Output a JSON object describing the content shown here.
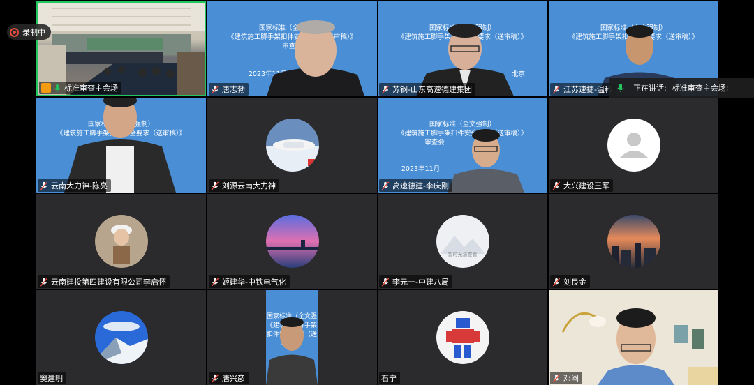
{
  "recording": {
    "label": "录制中"
  },
  "speaking": {
    "label": "正在讲话:",
    "name": "标准审查主会场;"
  },
  "slide": {
    "line1": "国家标准（全文强制）",
    "line2": "《建筑施工脚手架扣件安全要求（送审稿）》",
    "line3": "审查会",
    "date": "2023年11月",
    "place": "北京"
  },
  "participants": [
    {
      "name": "标准审查主会场",
      "kind": "room-video",
      "mic": "on"
    },
    {
      "name": "唐志勃",
      "kind": "slide-video",
      "mic": "muted"
    },
    {
      "name": "苏钢-山东高速德建集团",
      "kind": "slide-video",
      "mic": "muted"
    },
    {
      "name": "江苏速捷-温科",
      "kind": "slide-video",
      "mic": "muted"
    },
    {
      "name": "云南大力神-陈亮",
      "kind": "slide-video",
      "mic": "muted"
    },
    {
      "name": "刘源云南大力神",
      "kind": "avatar",
      "avatar": "airplane-avatar",
      "mic": "muted"
    },
    {
      "name": "高速德建-李庆刚",
      "kind": "slide-video",
      "mic": "muted"
    },
    {
      "name": "大兴建设王军",
      "kind": "avatar",
      "avatar": "default-person-avatar",
      "mic": "muted"
    },
    {
      "name": "云南建投第四建设有限公司李启怀",
      "kind": "avatar",
      "avatar": "child-hardhat-avatar",
      "mic": "muted"
    },
    {
      "name": "姬建华-中铁电气化",
      "kind": "avatar",
      "avatar": "sunset-lake-avatar",
      "mic": "muted"
    },
    {
      "name": "李元一-中建八局",
      "kind": "avatar",
      "avatar": "placeholder-avatar",
      "avatar_text": "暂时无法查看",
      "mic": "muted"
    },
    {
      "name": "刘良金",
      "kind": "avatar",
      "avatar": "city-sunset-avatar",
      "mic": "muted"
    },
    {
      "name": "窦建明",
      "kind": "avatar",
      "avatar": "mountain-avatar",
      "mic": "none"
    },
    {
      "name": "唐兴彦",
      "kind": "slide-video",
      "mic": "muted"
    },
    {
      "name": "石宁",
      "kind": "avatar",
      "avatar": "robot-toy-avatar",
      "mic": "none"
    },
    {
      "name": "邓阐",
      "kind": "room-video",
      "mic": "muted"
    }
  ],
  "colors": {
    "slide_blue": "#4a8fd6",
    "tile_bg": "#2b2b2d",
    "active_border": "#22c55e",
    "mic_muted": "#e74c3c",
    "mic_on": "#22c55e"
  }
}
